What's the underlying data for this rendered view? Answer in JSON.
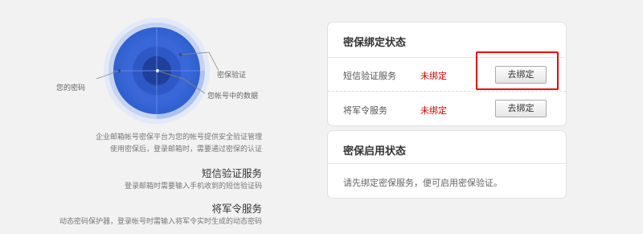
{
  "diagram": {
    "label_password": "您的密码",
    "label_security_verify": "密保验证",
    "label_account_data": "您帐号中的数据"
  },
  "intro": {
    "line1": "企业邮箱帐号密保平台为您的帐号提供安全验证管理",
    "line2": "使用密保后，登录邮箱时，需要通过密保的认证"
  },
  "features": [
    {
      "title": "短信验证服务",
      "desc": "登录邮箱时需要输入手机收到的短信验证码"
    },
    {
      "title": "将军令服务",
      "desc": "动态密码保护器，登录帐号时需输入将军令实时生成的动态密码"
    }
  ],
  "binding_card": {
    "title": "密保绑定状态",
    "rows": [
      {
        "label": "短信验证服务",
        "status": "未绑定",
        "button": "去绑定"
      },
      {
        "label": "将军令服务",
        "status": "未绑定",
        "button": "去绑定"
      }
    ]
  },
  "enable_card": {
    "title": "密保启用状态",
    "message": "请先绑定密保服务，便可启用密保验证。"
  },
  "colors": {
    "status_unbound": "#cc0000",
    "highlight_border": "#ee0000",
    "diagram_blue": "#3a6fd8"
  }
}
